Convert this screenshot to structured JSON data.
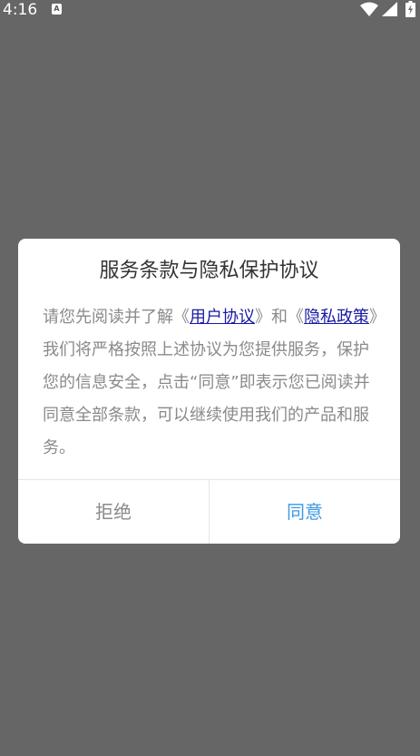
{
  "status_bar": {
    "time": "4:16",
    "notification_icon": "A",
    "icons": [
      "wifi-icon",
      "signal-icon",
      "battery-icon"
    ]
  },
  "dialog": {
    "title": "服务条款与隐私保护协议",
    "body": {
      "text_before_link1": "请您先阅读并了解《",
      "link1": "用户协议",
      "text_between": "》和《",
      "link2": "隐私政策",
      "text_after": "》我们将严格按照上述协议为您提供服务，保护您的信息安全，点击“同意”即表示您已阅读并同意全部条款，可以继续使用我们的产品和服务。"
    },
    "buttons": {
      "decline": "拒绝",
      "agree": "同意"
    }
  },
  "colors": {
    "overlay": "#666666",
    "link": "#1a1aa6",
    "agree": "#3b9ae5",
    "muted_text": "#8a8a8a"
  }
}
